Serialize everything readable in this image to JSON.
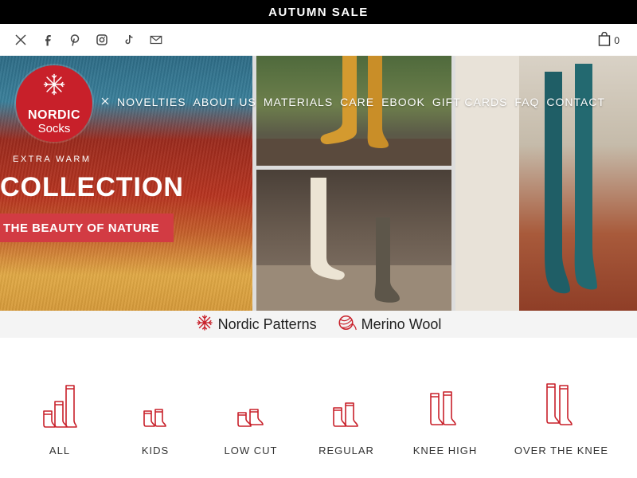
{
  "announcement": "AUTUMN SALE",
  "social_icons": [
    "x-icon",
    "facebook-icon",
    "pinterest-icon",
    "instagram-icon",
    "tiktok-icon",
    "mail-icon"
  ],
  "cart": {
    "count": "0"
  },
  "logo": {
    "line1": "NORDIC",
    "line2": "Socks"
  },
  "nav": [
    {
      "label": "NOVELTIES",
      "key": "novelties"
    },
    {
      "label": "ABOUT US",
      "key": "about-us"
    },
    {
      "label": "MATERIALS",
      "key": "materials"
    },
    {
      "label": "CARE",
      "key": "care"
    },
    {
      "label": "EBOOK",
      "key": "ebook"
    },
    {
      "label": "GIFT CARDS",
      "key": "gift-cards"
    },
    {
      "label": "FAQ",
      "key": "faq"
    },
    {
      "label": "CONTACT",
      "key": "contact"
    }
  ],
  "hero": {
    "kicker": "EXTRA WARM",
    "title": "COLLECTION",
    "band": "THE BEAUTY OF NATURE"
  },
  "features": [
    {
      "label": "Nordic Patterns",
      "icon": "snowflake-icon"
    },
    {
      "label": "Merino Wool",
      "icon": "yarn-ball-icon"
    }
  ],
  "categories": [
    {
      "label": "ALL",
      "key": "all"
    },
    {
      "label": "KIDS",
      "key": "kids"
    },
    {
      "label": "LOW CUT",
      "key": "low-cut"
    },
    {
      "label": "REGULAR",
      "key": "regular"
    },
    {
      "label": "KNEE HIGH",
      "key": "knee-high"
    },
    {
      "label": "OVER THE KNEE",
      "key": "over-the-knee"
    }
  ],
  "colors": {
    "brand_red": "#c8202a",
    "band_red": "#d23b43",
    "topbar": "#000000"
  }
}
